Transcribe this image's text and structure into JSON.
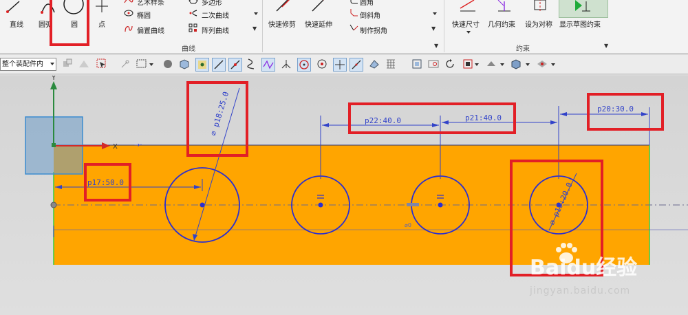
{
  "ribbon": {
    "curve_group": {
      "label": "曲线",
      "line": "直线",
      "arc": "圆弧",
      "circle": "圆",
      "point": "点",
      "studio_spline": "艺术样条",
      "ellipse": "椭圆",
      "offset_curve": "偏置曲线",
      "polygon": "多边形",
      "conic": "二次曲线",
      "pattern_curve": "阵列曲线",
      "quick_trim": "快速修剪",
      "quick_extend": "快速延伸",
      "fillet": "圆角",
      "chamfer": "倒斜角",
      "make_corner": "制作拐角"
    },
    "constraint_group": {
      "label": "约束",
      "rapid_dimension": "快速尺寸",
      "geometric_constraints": "几何约束",
      "make_symmetric": "设为对称",
      "show_sketch_constraints": "显示草图约束"
    }
  },
  "toolbar": {
    "selection_filter": "整个装配件内"
  },
  "sketch": {
    "dimensions": {
      "p17": "p17:50.0",
      "p18": "⌀ p18:25.0",
      "p19": "⌀ p19:20.0",
      "p20": "p20:30.0",
      "p21": "p21:40.0",
      "p22": "p22:40.0",
      "extra": "⌀0"
    },
    "axis_y": "Y",
    "axis_x": "X"
  },
  "watermark": {
    "logo": "Baidu经验",
    "url": "jingyan.baidu.com"
  },
  "colors": {
    "plate": "#ffa500",
    "dimension": "#3243c9",
    "highlight": "#e21f26",
    "origin_box": "#6e9cc8",
    "axis_y": "#2a8a3e",
    "axis_x": "#d22a2a"
  }
}
